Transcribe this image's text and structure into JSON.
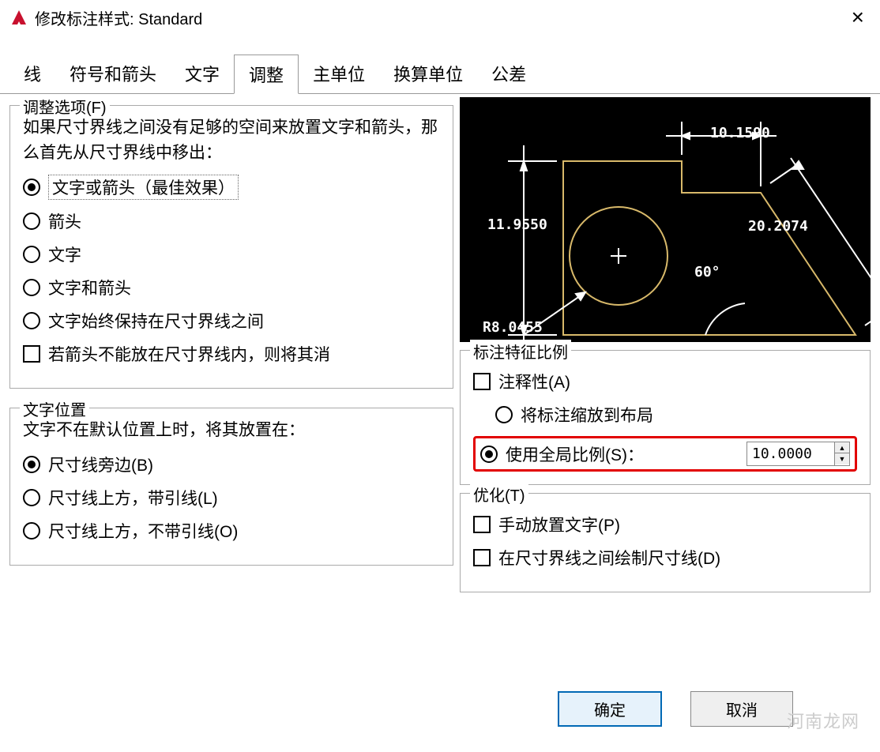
{
  "titlebar": {
    "title": "修改标注样式: Standard"
  },
  "tabs": {
    "t1": "线",
    "t2": "符号和箭头",
    "t3": "文字",
    "t4": "调整",
    "t5": "主单位",
    "t6": "换算单位",
    "t7": "公差"
  },
  "fit_options": {
    "legend": "调整选项(F)",
    "desc": "如果尺寸界线之间没有足够的空间来放置文字和箭头，那么首先从尺寸界线中移出：",
    "r1": "文字或箭头（最佳效果）",
    "r2": "箭头",
    "r3": "文字",
    "r4": "文字和箭头",
    "r5": "文字始终保持在尺寸界线之间",
    "c1": "若箭头不能放在尺寸界线内，则将其消"
  },
  "text_pos": {
    "legend": "文字位置",
    "desc": "文字不在默认位置上时，将其放置在：",
    "r1": "尺寸线旁边(B)",
    "r2": "尺寸线上方，带引线(L)",
    "r3": "尺寸线上方，不带引线(O)"
  },
  "scale": {
    "legend": "标注特征比例",
    "c_annot": "注释性(A)",
    "r_layout": "将标注缩放到布局",
    "r_global": "使用全局比例(S)：",
    "global_value": "10.0000"
  },
  "tune": {
    "legend": "优化(T)",
    "c1": "手动放置文字(P)",
    "c2": "在尺寸界线之间绘制尺寸线(D)"
  },
  "preview": {
    "dim_top": "10.1590",
    "dim_left": "11.9550",
    "dim_diag": "20.2074",
    "angle": "60°",
    "radius": "R8.0455"
  },
  "buttons": {
    "ok": "确定",
    "cancel": "取消"
  },
  "watermark": "河南龙网"
}
